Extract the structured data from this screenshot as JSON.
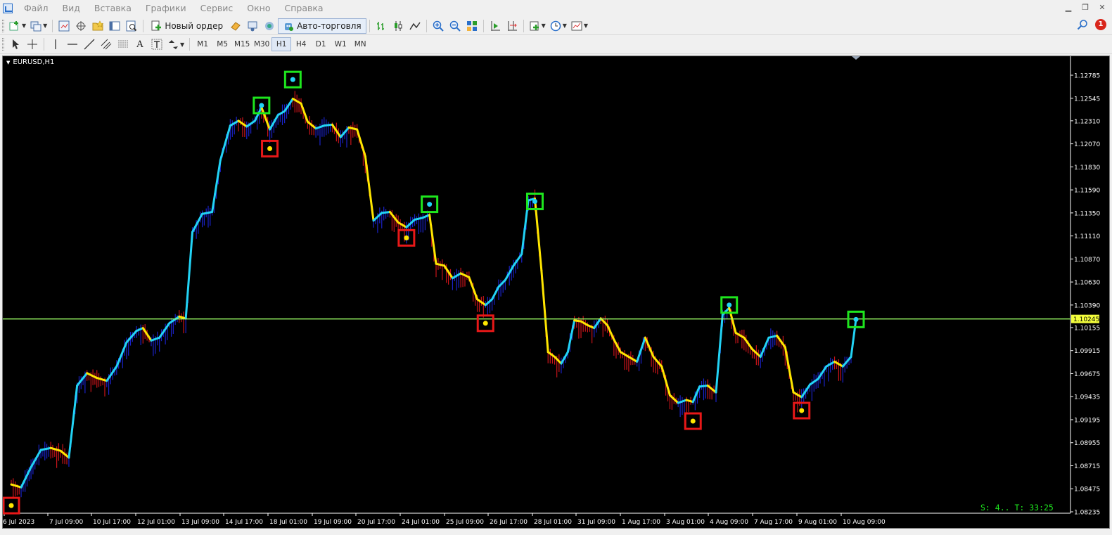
{
  "menu": [
    "Файл",
    "Вид",
    "Вставка",
    "Графики",
    "Сервис",
    "Окно",
    "Справка"
  ],
  "window_controls": [
    "minimize",
    "restore",
    "close"
  ],
  "toolbar": {
    "new_order_label": "Новый ордер",
    "autotrading_label": "Авто-торговля",
    "notifications_count": "1"
  },
  "timeframes": [
    "M1",
    "M5",
    "M15",
    "M30",
    "H1",
    "H4",
    "D1",
    "W1",
    "MN"
  ],
  "active_timeframe": "H1",
  "chart": {
    "symbol_label": "EURUSD,H1",
    "current_price_label": "1.10245",
    "status_text": "S: 4.. T: 33:25"
  },
  "chart_data": {
    "type": "line",
    "symbol": "EURUSD",
    "timeframe": "H1",
    "ylim": [
      1.0823,
      1.129
    ],
    "y_ticks": [
      "1.12785",
      "1.12545",
      "1.12310",
      "1.12070",
      "1.11830",
      "1.11590",
      "1.11350",
      "1.11110",
      "1.10870",
      "1.10630",
      "1.10390",
      "1.10155",
      "1.09915",
      "1.09675",
      "1.09435",
      "1.09195",
      "1.08955",
      "1.08715",
      "1.08475",
      "1.08235"
    ],
    "x_ticks": [
      "6 Jul 2023",
      "7 Jul 09:00",
      "10 Jul 17:00",
      "12 Jul 01:00",
      "13 Jul 09:00",
      "14 Jul 17:00",
      "18 Jul 01:00",
      "19 Jul 09:00",
      "20 Jul 17:00",
      "24 Jul 01:00",
      "25 Jul 09:00",
      "26 Jul 17:00",
      "28 Jul 01:00",
      "31 Jul 09:00",
      "1 Aug 17:00",
      "3 Aug 01:00",
      "4 Aug 09:00",
      "7 Aug 17:00",
      "9 Aug 01:00",
      "10 Aug 09:00"
    ],
    "current_price": 1.10245,
    "price_series": [
      [
        0,
        1.0852
      ],
      [
        6,
        1.0849
      ],
      [
        12,
        1.087
      ],
      [
        18,
        1.0888
      ],
      [
        24,
        1.089
      ],
      [
        30,
        1.0887
      ],
      [
        35,
        1.088
      ],
      [
        40,
        1.0955
      ],
      [
        46,
        1.0968
      ],
      [
        52,
        1.0963
      ],
      [
        58,
        1.096
      ],
      [
        64,
        1.0975
      ],
      [
        70,
        1.1
      ],
      [
        76,
        1.1012
      ],
      [
        80,
        1.1015
      ],
      [
        85,
        1.1002
      ],
      [
        90,
        1.1005
      ],
      [
        96,
        1.102
      ],
      [
        102,
        1.1027
      ],
      [
        106,
        1.1025
      ],
      [
        110,
        1.1115
      ],
      [
        116,
        1.1134
      ],
      [
        122,
        1.1136
      ],
      [
        127,
        1.119
      ],
      [
        133,
        1.1226
      ],
      [
        138,
        1.1231
      ],
      [
        143,
        1.1225
      ],
      [
        148,
        1.1231
      ],
      [
        152,
        1.1245
      ],
      [
        157,
        1.1222
      ],
      [
        162,
        1.1237
      ],
      [
        166,
        1.1241
      ],
      [
        171,
        1.1254
      ],
      [
        176,
        1.1249
      ],
      [
        180,
        1.123
      ],
      [
        185,
        1.1223
      ],
      [
        190,
        1.1226
      ],
      [
        195,
        1.1227
      ],
      [
        200,
        1.1214
      ],
      [
        205,
        1.1224
      ],
      [
        210,
        1.1222
      ],
      [
        215,
        1.1194
      ],
      [
        220,
        1.1127
      ],
      [
        225,
        1.1135
      ],
      [
        230,
        1.1136
      ],
      [
        235,
        1.1125
      ],
      [
        240,
        1.112
      ],
      [
        245,
        1.1128
      ],
      [
        250,
        1.113
      ],
      [
        254,
        1.1133
      ],
      [
        258,
        1.1082
      ],
      [
        263,
        1.108
      ],
      [
        268,
        1.1067
      ],
      [
        273,
        1.1072
      ],
      [
        278,
        1.1068
      ],
      [
        283,
        1.1045
      ],
      [
        288,
        1.1039
      ],
      [
        292,
        1.1045
      ],
      [
        296,
        1.1058
      ],
      [
        300,
        1.1065
      ],
      [
        305,
        1.108
      ],
      [
        310,
        1.1092
      ],
      [
        314,
        1.1148
      ],
      [
        318,
        1.115
      ],
      [
        322,
        1.1075
      ],
      [
        326,
        1.099
      ],
      [
        330,
        1.0985
      ],
      [
        334,
        1.0978
      ],
      [
        338,
        1.099
      ],
      [
        342,
        1.1023
      ],
      [
        346,
        1.1022
      ],
      [
        350,
        1.1018
      ],
      [
        354,
        1.1015
      ],
      [
        358,
        1.1025
      ],
      [
        362,
        1.1018
      ],
      [
        366,
        1.1003
      ],
      [
        370,
        1.099
      ],
      [
        375,
        1.0985
      ],
      [
        380,
        1.098
      ],
      [
        385,
        1.1005
      ],
      [
        390,
        1.0985
      ],
      [
        395,
        1.0975
      ],
      [
        400,
        1.0945
      ],
      [
        405,
        1.0937
      ],
      [
        410,
        1.094
      ],
      [
        414,
        1.0938
      ],
      [
        418,
        1.0954
      ],
      [
        423,
        1.0955
      ],
      [
        428,
        1.0948
      ],
      [
        432,
        1.1029
      ],
      [
        436,
        1.1036
      ],
      [
        440,
        1.101
      ],
      [
        445,
        1.1005
      ],
      [
        450,
        1.0993
      ],
      [
        455,
        1.0985
      ],
      [
        460,
        1.1005
      ],
      [
        465,
        1.1007
      ],
      [
        470,
        1.0995
      ],
      [
        475,
        1.0948
      ],
      [
        480,
        1.0943
      ],
      [
        485,
        1.0956
      ],
      [
        490,
        1.0962
      ],
      [
        495,
        1.0975
      ],
      [
        500,
        1.098
      ],
      [
        505,
        1.0975
      ],
      [
        510,
        1.0985
      ],
      [
        513,
        1.1024
      ]
    ],
    "swing_highs": [
      [
        152,
        1.1247
      ],
      [
        171,
        1.1274
      ],
      [
        254,
        1.1144
      ],
      [
        318,
        1.1147
      ],
      [
        436,
        1.1039
      ],
      [
        513,
        1.1024
      ]
    ],
    "swing_lows": [
      [
        0,
        1.083
      ],
      [
        157,
        1.1202
      ],
      [
        240,
        1.1109
      ],
      [
        288,
        1.102
      ],
      [
        414,
        1.0918
      ],
      [
        480,
        1.0929
      ]
    ]
  }
}
